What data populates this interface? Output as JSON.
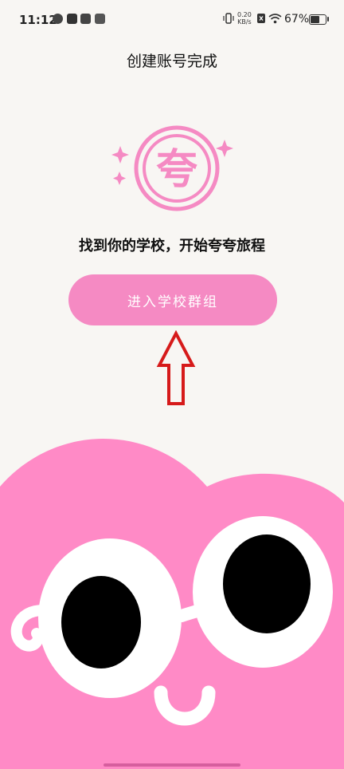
{
  "status_bar": {
    "time": "11:12",
    "net_speed_value": "0.20",
    "net_speed_unit": "KB/s",
    "battery": "67%",
    "battery_level": 0.67
  },
  "header": {
    "title": "创建账号完成"
  },
  "logo": {
    "glyph": "夸"
  },
  "main": {
    "subtitle": "找到你的学校，开始夸夸旅程",
    "join_button": "进入学校群组"
  },
  "colors": {
    "accent": "#f58ac3",
    "mascot": "#ff8ac6",
    "background": "#f8f6f3",
    "arrow": "#d61a1a"
  },
  "icons": [
    "check-circle-icon",
    "play-box-icon",
    "app-icon",
    "bag-icon",
    "vibrate-icon",
    "sim-icon",
    "wifi-icon",
    "battery-icon",
    "sparkle-icon"
  ]
}
